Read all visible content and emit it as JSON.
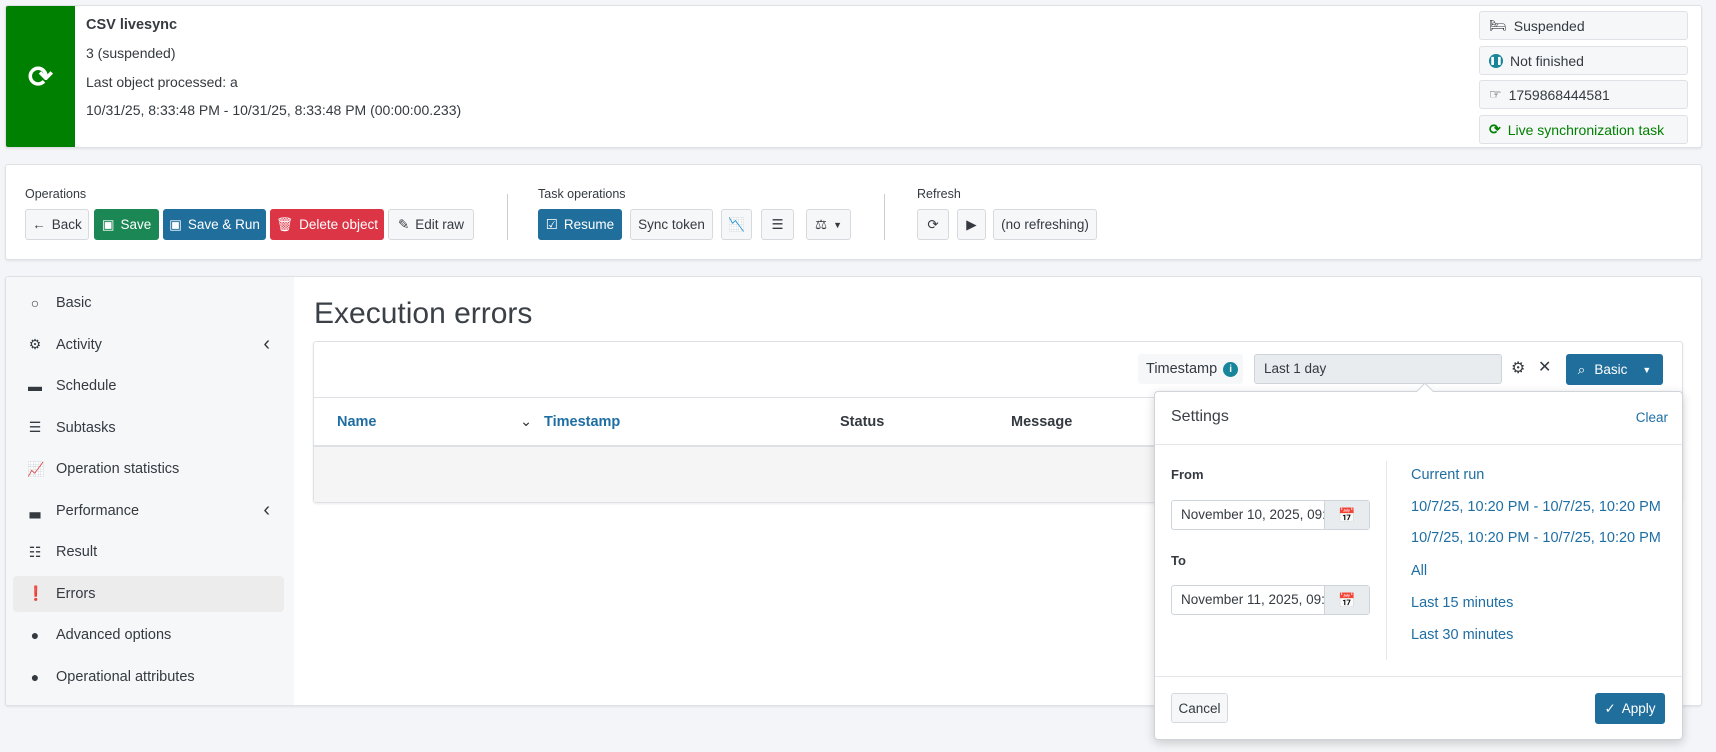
{
  "header": {
    "title": "CSV livesync",
    "status_line": "3 (suspended)",
    "last_object": "Last object processed: a",
    "time_range": "10/31/25, 8:33:48 PM - 10/31/25, 8:33:48 PM (00:00:00.233)",
    "icon": "sync-icon",
    "accent": "#008000",
    "badges": [
      {
        "icon": "bed-icon",
        "label": "Suspended"
      },
      {
        "icon": "pause-circle-icon",
        "label": "Not finished"
      },
      {
        "icon": "hand-pointer-icon",
        "label": "1759868444581"
      },
      {
        "icon": "sync-icon",
        "label": "Live synchronization task",
        "color": "#008000"
      }
    ]
  },
  "toolbar": {
    "operations_label": "Operations",
    "back": "Back",
    "save": "Save",
    "save_run": "Save & Run",
    "delete": "Delete object",
    "edit_raw": "Edit raw",
    "task_operations_label": "Task operations",
    "resume": "Resume",
    "sync_token": "Sync token",
    "refresh_label": "Refresh",
    "no_refreshing": "(no refreshing)"
  },
  "sidebar": {
    "items": [
      {
        "label": "Basic",
        "icon": "circle-outline-icon"
      },
      {
        "label": "Activity",
        "icon": "gear-icon"
      },
      {
        "label": "Schedule",
        "icon": "calendar-icon"
      },
      {
        "label": "Subtasks",
        "icon": "task-list-icon"
      },
      {
        "label": "Operation statistics",
        "icon": "line-chart-icon"
      },
      {
        "label": "Performance",
        "icon": "area-chart-icon"
      },
      {
        "label": "Result",
        "icon": "list-icon"
      },
      {
        "label": "Errors",
        "icon": "exclamation-circle-icon",
        "active": true
      },
      {
        "label": "Advanced options",
        "icon": "circle-icon"
      },
      {
        "label": "Operational attributes",
        "icon": "circle-icon"
      }
    ]
  },
  "main": {
    "title": "Execution errors",
    "search": {
      "field_label": "Timestamp",
      "value": "Last 1 day",
      "mode": "Basic"
    },
    "columns": [
      "Name",
      "Timestamp",
      "Status",
      "Message"
    ]
  },
  "popover": {
    "title": "Settings",
    "clear": "Clear",
    "from_label": "From",
    "from_value": "November 10, 2025, 09:…",
    "to_label": "To",
    "to_value": "November 11, 2025, 09:…",
    "presets": [
      "Current run",
      "10/7/25, 10:20 PM - 10/7/25, 10:20 PM",
      "10/7/25, 10:20 PM - 10/7/25, 10:20 PM",
      "All",
      "Last 15 minutes",
      "Last 30 minutes"
    ],
    "cancel": "Cancel",
    "apply": "Apply"
  }
}
